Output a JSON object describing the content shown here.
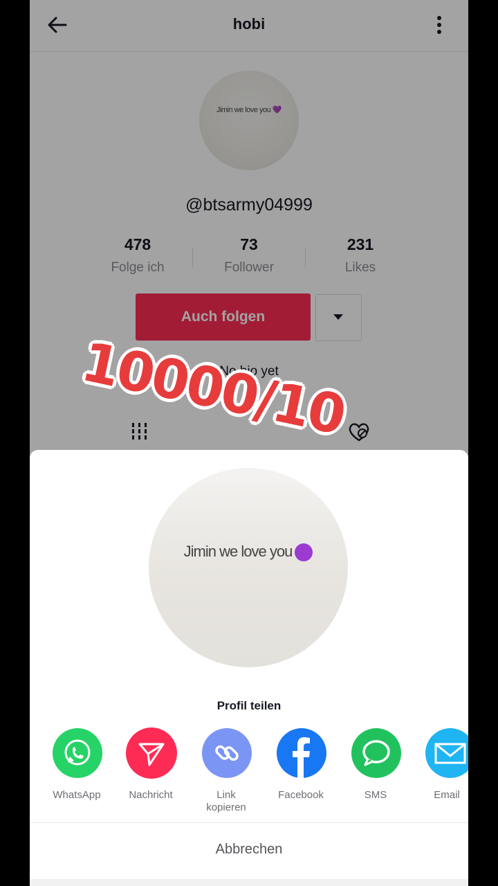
{
  "header": {
    "title": "hobi",
    "back_icon": "arrow-left-icon",
    "more_icon": "more-vertical-icon"
  },
  "profile": {
    "avatar_caption": "Jimin we love you 💜",
    "username": "@btsarmy04999",
    "stats": [
      {
        "value": "478",
        "label": "Folge ich"
      },
      {
        "value": "73",
        "label": "Follower"
      },
      {
        "value": "231",
        "label": "Likes"
      }
    ],
    "follow_label": "Auch folgen",
    "bio": "No bio yet"
  },
  "sticker": {
    "text": "10000/10",
    "color": "#e73c3c"
  },
  "share": {
    "avatar_caption": "Jimin we love you",
    "title": "Profil teilen",
    "apps": [
      {
        "label": "WhatsApp",
        "icon": "whatsapp-icon",
        "color": "#25d366"
      },
      {
        "label": "Nachricht",
        "icon": "send-icon",
        "color": "#fe2c55"
      },
      {
        "label": "Link\nkopieren",
        "icon": "link-icon",
        "color": "#7b95f5"
      },
      {
        "label": "Facebook",
        "icon": "facebook-icon",
        "color": "#1877f2"
      },
      {
        "label": "SMS",
        "icon": "sms-icon",
        "color": "#21c25e"
      },
      {
        "label": "Email",
        "icon": "mail-icon",
        "color": "#1fb4f2"
      }
    ],
    "cancel_label": "Abbrechen"
  }
}
